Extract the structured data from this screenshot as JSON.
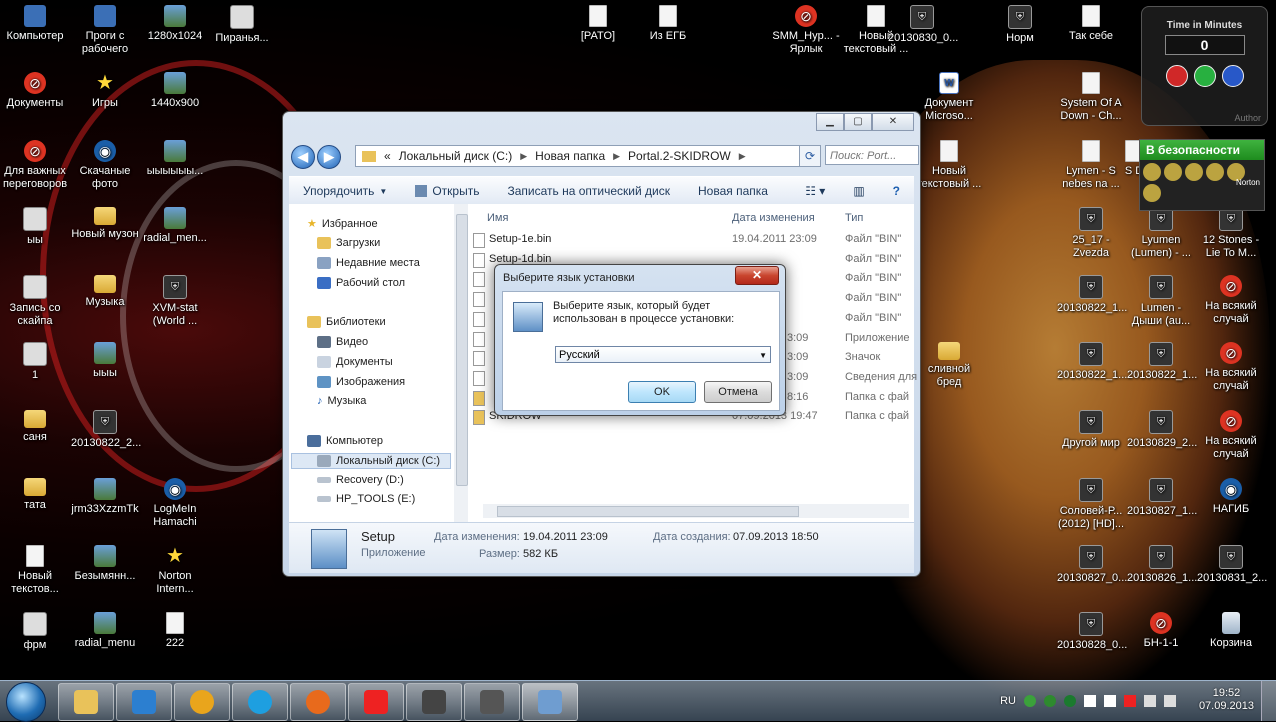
{
  "desktop": {
    "icons": [
      {
        "label": "Компьютер",
        "type": "pc"
      },
      {
        "label": "Проги с рабочего",
        "type": "pc"
      },
      {
        "label": "1280x1024",
        "type": "img"
      },
      {
        "label": "Пиранья...",
        "type": "net"
      },
      {
        "label": "[PATO]",
        "type": "file"
      },
      {
        "label": "Из ЕГБ",
        "type": "file"
      },
      {
        "label": "SMM_Hyp... - Ярлык",
        "type": "red"
      },
      {
        "label": "Новый текстовый ...",
        "type": "file"
      },
      {
        "label": "20130830_0...",
        "type": "tank"
      },
      {
        "label": "Норм",
        "type": "tank"
      },
      {
        "label": "Так себе",
        "type": "file"
      },
      {
        "label": "Документы",
        "type": "red"
      },
      {
        "label": "Игры",
        "type": "star"
      },
      {
        "label": "1440x900",
        "type": "img"
      },
      {
        "label": "Документ Microso...",
        "type": "doc"
      },
      {
        "label": "System Of A Down - Ch...",
        "type": "file"
      },
      {
        "label": "Для важных переговоров",
        "type": "red"
      },
      {
        "label": "Скачаные фото",
        "type": "blue"
      },
      {
        "label": "ыыыыыы...",
        "type": "img"
      },
      {
        "label": "Новый текстовый ...",
        "type": "file"
      },
      {
        "label": "Lymen - S nebes na ...",
        "type": "file"
      },
      {
        "label": "S D",
        "type": "file"
      },
      {
        "label": "ыы",
        "type": "net"
      },
      {
        "label": "Новый музон",
        "type": "folder"
      },
      {
        "label": "radial_men...",
        "type": "img"
      },
      {
        "label": "25_17 - Zvezda",
        "type": "tank"
      },
      {
        "label": "Lyumen (Lumen) - ...",
        "type": "tank"
      },
      {
        "label": "12 Stones - Lie To M...",
        "type": "tank"
      },
      {
        "label": "Запись со скайпа",
        "type": "net"
      },
      {
        "label": "Музыка",
        "type": "folder"
      },
      {
        "label": "XVM-stat (World ...",
        "type": "tank"
      },
      {
        "label": "20130822_1...",
        "type": "tank"
      },
      {
        "label": "Lumen - Дыши (au...",
        "type": "tank"
      },
      {
        "label": "На всякий случай",
        "type": "red"
      },
      {
        "label": "1",
        "type": "net"
      },
      {
        "label": "ыыы",
        "type": "img"
      },
      {
        "label": "сливной бред",
        "type": "folder"
      },
      {
        "label": "20130822_1...",
        "type": "tank"
      },
      {
        "label": "20130822_1...",
        "type": "tank"
      },
      {
        "label": "На всякий случай",
        "type": "red"
      },
      {
        "label": "саня",
        "type": "folder"
      },
      {
        "label": "20130822_2...",
        "type": "tank"
      },
      {
        "label": "Другой мир",
        "type": "tank"
      },
      {
        "label": "20130829_2...",
        "type": "tank"
      },
      {
        "label": "На всякий случай",
        "type": "red"
      },
      {
        "label": "тата",
        "type": "folder"
      },
      {
        "label": "jrm33XzzmTk",
        "type": "img"
      },
      {
        "label": "LogMeIn Hamachi",
        "type": "blue"
      },
      {
        "label": "Соловей-Р... (2012) [HD]...",
        "type": "tank"
      },
      {
        "label": "20130827_1...",
        "type": "tank"
      },
      {
        "label": "НАГИБ",
        "type": "blue"
      },
      {
        "label": "Новый текстов...",
        "type": "file"
      },
      {
        "label": "Безымянн...",
        "type": "img"
      },
      {
        "label": "Norton Intern...",
        "type": "star"
      },
      {
        "label": "20130827_0...",
        "type": "tank"
      },
      {
        "label": "20130826_1...",
        "type": "tank"
      },
      {
        "label": "20130831_2...",
        "type": "tank"
      },
      {
        "label": "фрм",
        "type": "net"
      },
      {
        "label": "radial_menu",
        "type": "img"
      },
      {
        "label": "222",
        "type": "file"
      },
      {
        "label": "20130828_0...",
        "type": "tank"
      },
      {
        "label": "БН-1-1",
        "type": "red"
      },
      {
        "label": "Корзина",
        "type": "trash"
      }
    ]
  },
  "gadget": {
    "title": "Time in Minutes",
    "value": "0",
    "author": "Author"
  },
  "norton": {
    "status": "В безопасности",
    "brand": "Norton"
  },
  "explorer": {
    "path": [
      "«",
      "Локальный диск (C:)",
      "Новая папка",
      "Portal.2-SKIDROW"
    ],
    "search_placeholder": "Поиск: Port...",
    "toolbar": {
      "organize": "Упорядочить",
      "open": "Открыть",
      "burn": "Записать на оптический диск",
      "new_folder": "Новая папка"
    },
    "nav": {
      "favorites": "Избранное",
      "downloads": "Загрузки",
      "recent": "Недавние места",
      "desktop": "Рабочий стол",
      "libraries": "Библиотеки",
      "video": "Видео",
      "documents": "Документы",
      "images": "Изображения",
      "music": "Музыка",
      "computer": "Компьютер",
      "local_c": "Локальный диск (C:)",
      "recovery": "Recovery (D:)",
      "hp_tools": "HP_TOOLS (E:)"
    },
    "columns": {
      "name": "Имя",
      "date": "Дата изменения",
      "type": "Тип"
    },
    "files": [
      {
        "name": "Setup-1e.bin",
        "date": "19.04.2011 23:09",
        "type": "Файл \"BIN\""
      },
      {
        "name": "Setup-1d.bin",
        "date": "",
        "type": "Файл \"BIN\""
      },
      {
        "name": "",
        "date": "",
        "type": "Файл \"BIN\""
      },
      {
        "name": "",
        "date": "",
        "type": "Файл \"BIN\""
      },
      {
        "name": "",
        "date": "",
        "type": "Файл \"BIN\""
      },
      {
        "name": "",
        "date": "3:09",
        "type": "Приложение"
      },
      {
        "name": "",
        "date": "3:09",
        "type": "Значок"
      },
      {
        "name": "",
        "date": "3:09",
        "type": "Сведения для"
      },
      {
        "name": "",
        "date": "8:16",
        "type": "Папка с фай"
      },
      {
        "name": "SKIDROW",
        "date": "07.09.2013 19:47",
        "type": "Папка с фай"
      }
    ],
    "details": {
      "name": "Setup",
      "kind": "Приложение",
      "modified_label": "Дата изменения:",
      "modified": "19.04.2011 23:09",
      "size_label": "Размер:",
      "size": "582 КБ",
      "created_label": "Дата создания:",
      "created": "07.09.2013 18:50"
    }
  },
  "dialog": {
    "title": "Выберите язык установки",
    "close": "✕",
    "message": "Выберите язык, который будет использован в процессе установки:",
    "selected": "Русский",
    "ok": "OK",
    "cancel": "Отмена"
  },
  "taskbar": {
    "lang": "RU",
    "time": "19:52",
    "date": "07.09.2013"
  }
}
